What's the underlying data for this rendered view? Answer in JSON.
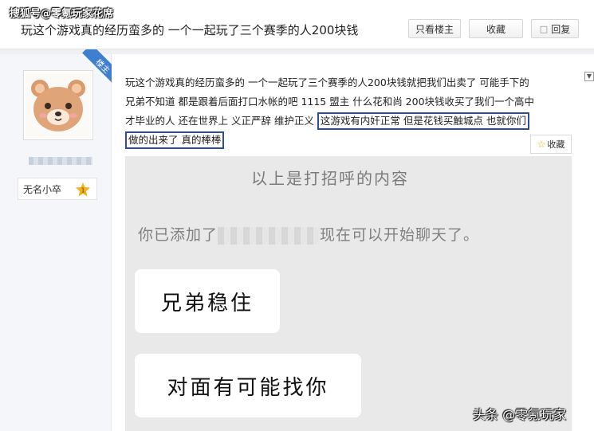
{
  "watermark": {
    "top": "搜狐号@零氪玩家花席",
    "bottom": "头条 @零氪玩家"
  },
  "header": {
    "title": "玩这个游戏真的经历蛮多的 一个一起玩了三个赛季的人200块钱",
    "only_op_label": "只看楼主",
    "favorite_label": "收藏",
    "reply_label": "回复"
  },
  "user": {
    "badge": "楼主",
    "avatar_icon": "bear-avatar-icon",
    "rank_label": "无名小卒",
    "level": "1"
  },
  "post": {
    "lines": [
      "玩这个游戏真的经历蛮多的 一个一起玩了三个赛季的人200块钱就把我们出卖了 可能手下的",
      "兄弟不知道 都是跟着后面打口水帐的吧 1115 盟主 什么花和尚 200块钱收买了我们一个高中"
    ],
    "line3_plain": "才毕业的人 还在世界上 义正严辞 维护正义 ",
    "line3_highlight": "这游戏有内奸正常 但是花钱买触城点 也就你们",
    "line4_highlight": "做的出来了 真的棒棒",
    "collect_label": "收藏"
  },
  "chat": {
    "greeting_notice": "以上是打招呼的内容",
    "added_prefix": "你已添加了",
    "added_suffix": "现在可以开始聊天了。",
    "messages": [
      "兄弟稳住",
      "对面有可能找你"
    ]
  },
  "colors": {
    "highlight_border": "#2d4e9a",
    "ribbon": "#3f7fd0",
    "chat_bg": "#e9e9e9"
  }
}
